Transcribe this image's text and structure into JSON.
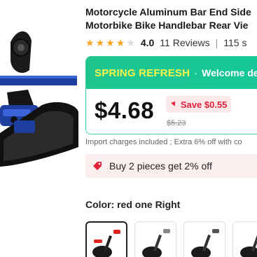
{
  "product": {
    "title_line1": "Motorcycle Aluminum Bar End Side",
    "title_line2": "Motorbike Bike Handlebar Rear Vie"
  },
  "rating": {
    "stars_filled": 4,
    "stars_total": 5,
    "value": "4.0",
    "reviews": "11 Reviews",
    "separator": "|",
    "sold": "115 s",
    "star_color": "#f5a623"
  },
  "promo": {
    "tag": "SPRING REFRESH",
    "dot": "·",
    "welcome": "Welcome de",
    "accent": "#1ec68e",
    "tag_color": "#f7f34a"
  },
  "price": {
    "current": "$4.68",
    "save": "Save $0.55",
    "original": "$5.23",
    "save_color": "#e0223a"
  },
  "import_note": "Import charges included ; Extra 6% off with co",
  "discount": {
    "text": "Buy 2 pieces get 2% off",
    "icon": "tag-icon"
  },
  "color": {
    "label": "Color:",
    "value": "red one Right",
    "options": [
      {
        "name": "red one Right",
        "selected": true
      },
      {
        "name": "option-2",
        "selected": false
      },
      {
        "name": "option-3",
        "selected": false
      },
      {
        "name": "option-4",
        "selected": false
      }
    ]
  }
}
